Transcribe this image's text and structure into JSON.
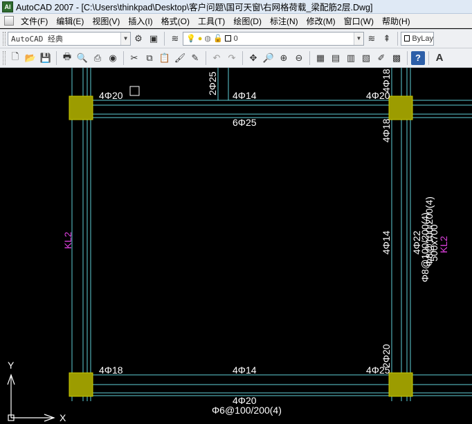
{
  "window": {
    "app_icon_text": "AI",
    "title": "AutoCAD 2007 - [C:\\Users\\thinkpad\\Desktop\\客户问题\\国可天窗\\右网格荷载_梁配筋2层.Dwg]"
  },
  "menu": {
    "items": [
      "文件(F)",
      "编辑(E)",
      "视图(V)",
      "插入(I)",
      "格式(O)",
      "工具(T)",
      "绘图(D)",
      "标注(N)",
      "修改(M)",
      "窗口(W)",
      "帮助(H)"
    ]
  },
  "toolbar1": {
    "workspace": "AutoCAD 经典",
    "layer": "0",
    "bylayer": "ByLay"
  },
  "toolbar2": {
    "icons": [
      "new-icon",
      "open-icon",
      "save-icon",
      "plot-icon",
      "preview-icon",
      "publish-icon",
      "3d-dwf-icon",
      "cut-icon",
      "copy-icon",
      "paste-icon",
      "match-properties-icon",
      "brush-icon",
      "undo-icon",
      "redo-icon",
      "pan-icon",
      "zoom-realtime-icon",
      "zoom-window-icon",
      "zoom-previous-icon",
      "properties-icon",
      "design-center-icon",
      "tool-palettes-icon",
      "sheet-set-icon",
      "markup-icon",
      "calculator-icon",
      "help-icon"
    ]
  },
  "drawing": {
    "labels": {
      "top_left": "4Φ20",
      "top_mid": "4Φ14",
      "top_right": "4Φ20",
      "top_vertical": "2Φ25",
      "right_col_top": "4Φ18",
      "beam_bottom_top": "6Φ25",
      "right_col_mid_top": "4Φ18",
      "left_beam_name": "KL2",
      "right_beam_name": "KL2",
      "right_size": "500x700",
      "right_stirrup_a": "Φ8@100/200(4)",
      "right_stirrup_b": "Φ8@100/200(4)",
      "right_22": "4Φ22",
      "right_14": "4Φ14",
      "bottom_left": "4Φ18",
      "bottom_mid": "4Φ14",
      "bottom_right": "4Φ25",
      "bottom_vertical": "2Φ20",
      "bottom_under": "4Φ20",
      "bottom_stirrup": "Φ6@100/200(4)"
    },
    "ucs": {
      "x": "X",
      "y": "Y"
    }
  },
  "colors": {
    "background": "#000000",
    "beam_line": "#5fd0d8",
    "column_fill": "#9c9c00",
    "text": "#ffffff",
    "magenta": "#e040e0"
  }
}
